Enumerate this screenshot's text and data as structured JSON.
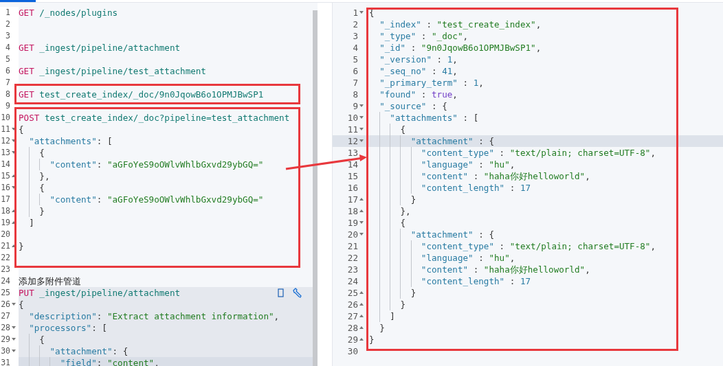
{
  "request_pane": {
    "action_icons": true,
    "lines": [
      {
        "n": "1",
        "fold_open": false,
        "fold_close": false,
        "framed": false,
        "in_request": false,
        "active": false,
        "tokens": [
          {
            "kind": "method",
            "text": "GET"
          },
          {
            "kind": "url",
            "text": "/_nodes/plugins"
          }
        ]
      },
      {
        "n": "2",
        "fold_open": false,
        "fold_close": false,
        "framed": false,
        "in_request": false,
        "active": false
      },
      {
        "n": "3",
        "fold_open": false,
        "fold_close": false,
        "framed": false,
        "in_request": false,
        "active": false
      },
      {
        "n": "4",
        "fold_open": false,
        "fold_close": false,
        "framed": false,
        "in_request": false,
        "active": false,
        "tokens": [
          {
            "kind": "method",
            "text": "GET"
          },
          {
            "kind": "url",
            "text": "_ingest/pipeline/attachment"
          }
        ]
      },
      {
        "n": "5",
        "fold_open": false,
        "fold_close": false,
        "framed": false,
        "in_request": false,
        "active": false
      },
      {
        "n": "6",
        "fold_open": false,
        "fold_close": false,
        "framed": false,
        "in_request": false,
        "active": false,
        "tokens": [
          {
            "kind": "method",
            "text": "GET"
          },
          {
            "kind": "url",
            "text": "_ingest/pipeline/test_attachment"
          }
        ]
      },
      {
        "n": "7",
        "fold_open": false,
        "fold_close": false,
        "framed": false,
        "in_request": false,
        "active": false
      },
      {
        "n": "8",
        "fold_open": false,
        "fold_close": false,
        "framed": true,
        "in_request": false,
        "active": false,
        "tokens": [
          {
            "kind": "method",
            "text": "GET"
          },
          {
            "kind": "url",
            "text": "test_create_index/_doc/9n0JqowB6o1OPMJBwSP1"
          }
        ]
      },
      {
        "n": "9",
        "fold_open": false,
        "fold_close": false,
        "framed": false,
        "in_request": false,
        "active": false
      },
      {
        "n": "10",
        "fold_open": false,
        "fold_close": false,
        "framed": true,
        "in_request": false,
        "active": false,
        "tokens": [
          {
            "kind": "method",
            "text": "POST"
          },
          {
            "kind": "url",
            "text": "test_create_index/_doc?pipeline=test_attachment"
          }
        ]
      },
      {
        "n": "11",
        "fold_open": true,
        "fold_close": false,
        "framed": true,
        "in_request": false,
        "active": false,
        "tokens": [
          {
            "kind": "punct",
            "text": "{"
          }
        ]
      },
      {
        "n": "12",
        "fold_open": true,
        "fold_close": false,
        "framed": true,
        "in_request": false,
        "active": false,
        "tokens": [
          {
            "kind": "key",
            "text": "  \"attachments\""
          },
          {
            "kind": "punct",
            "text": ": ["
          }
        ]
      },
      {
        "n": "13",
        "fold_open": true,
        "fold_close": false,
        "framed": true,
        "in_request": false,
        "active": false,
        "tokens": [
          {
            "kind": "punct",
            "text": "    {"
          }
        ]
      },
      {
        "n": "14",
        "fold_open": false,
        "fold_close": false,
        "framed": true,
        "in_request": false,
        "active": false,
        "tokens": [
          {
            "kind": "key",
            "text": "      \"content\""
          },
          {
            "kind": "punct",
            "text": ": "
          },
          {
            "kind": "string",
            "text": "\"aGFoYeS9oOWlvWhlbGxvd29ybGQ=\""
          }
        ]
      },
      {
        "n": "15",
        "fold_open": false,
        "fold_close": true,
        "framed": true,
        "in_request": false,
        "active": false,
        "tokens": [
          {
            "kind": "punct",
            "text": "    },"
          }
        ]
      },
      {
        "n": "16",
        "fold_open": true,
        "fold_close": false,
        "framed": true,
        "in_request": false,
        "active": false,
        "tokens": [
          {
            "kind": "punct",
            "text": "    {"
          }
        ]
      },
      {
        "n": "17",
        "fold_open": false,
        "fold_close": false,
        "framed": true,
        "in_request": false,
        "active": false,
        "tokens": [
          {
            "kind": "key",
            "text": "      \"content\""
          },
          {
            "kind": "punct",
            "text": ": "
          },
          {
            "kind": "string",
            "text": "\"aGFoYeS9oOWlvWhlbGxvd29ybGQ=\""
          }
        ]
      },
      {
        "n": "18",
        "fold_open": false,
        "fold_close": true,
        "framed": true,
        "in_request": false,
        "active": false,
        "tokens": [
          {
            "kind": "punct",
            "text": "    }"
          }
        ]
      },
      {
        "n": "19",
        "fold_open": false,
        "fold_close": true,
        "framed": true,
        "in_request": false,
        "active": false,
        "tokens": [
          {
            "kind": "punct",
            "text": "  ]"
          }
        ]
      },
      {
        "n": "20",
        "fold_open": false,
        "fold_close": false,
        "framed": true,
        "in_request": false,
        "active": false
      },
      {
        "n": "21",
        "fold_open": false,
        "fold_close": true,
        "framed": true,
        "in_request": false,
        "active": false,
        "tokens": [
          {
            "kind": "punct",
            "text": "}"
          }
        ]
      },
      {
        "n": "22",
        "fold_open": false,
        "fold_close": false,
        "framed": true,
        "in_request": false,
        "active": false
      },
      {
        "n": "23",
        "fold_open": false,
        "fold_close": false,
        "framed": false,
        "in_request": false,
        "active": false
      },
      {
        "n": "24",
        "fold_open": false,
        "fold_close": false,
        "framed": false,
        "in_request": false,
        "active": false,
        "tokens": [
          {
            "kind": "comment",
            "text": "添加多附件管道"
          }
        ]
      },
      {
        "n": "25",
        "fold_open": false,
        "fold_close": false,
        "framed": false,
        "in_request": true,
        "active": false,
        "tokens": [
          {
            "kind": "method",
            "text": "PUT"
          },
          {
            "kind": "url",
            "text": "_ingest/pipeline/attachment"
          }
        ]
      },
      {
        "n": "26",
        "fold_open": true,
        "fold_close": false,
        "framed": false,
        "in_request": true,
        "active": false,
        "tokens": [
          {
            "kind": "punct",
            "text": "{"
          }
        ]
      },
      {
        "n": "27",
        "fold_open": false,
        "fold_close": false,
        "framed": false,
        "in_request": true,
        "active": false,
        "tokens": [
          {
            "kind": "key",
            "text": "  \"description\""
          },
          {
            "kind": "punct",
            "text": ": "
          },
          {
            "kind": "string",
            "text": "\"Extract attachment information\""
          },
          {
            "kind": "punct",
            "text": ","
          }
        ]
      },
      {
        "n": "28",
        "fold_open": true,
        "fold_close": false,
        "framed": false,
        "in_request": true,
        "active": false,
        "tokens": [
          {
            "kind": "key",
            "text": "  \"processors\""
          },
          {
            "kind": "punct",
            "text": ": ["
          }
        ]
      },
      {
        "n": "29",
        "fold_open": true,
        "fold_close": false,
        "framed": false,
        "in_request": true,
        "active": false,
        "tokens": [
          {
            "kind": "punct",
            "text": "    {"
          }
        ]
      },
      {
        "n": "30",
        "fold_open": true,
        "fold_close": false,
        "framed": false,
        "in_request": true,
        "active": false,
        "tokens": [
          {
            "kind": "key",
            "text": "      \"attachment\""
          },
          {
            "kind": "punct",
            "text": ": {"
          }
        ]
      },
      {
        "n": "31",
        "fold_open": false,
        "fold_close": false,
        "framed": false,
        "in_request": true,
        "active": true,
        "tokens": [
          {
            "kind": "key",
            "text": "        \"field\""
          },
          {
            "kind": "punct",
            "text": ": "
          },
          {
            "kind": "string",
            "text": "\"content\""
          },
          {
            "kind": "punct",
            "text": ","
          }
        ]
      }
    ]
  },
  "response_pane": {
    "lines": [
      {
        "n": "1",
        "fold_open": true,
        "fold_close": false,
        "framed": true,
        "active": false,
        "tokens": [
          {
            "kind": "punct",
            "text": "{"
          }
        ]
      },
      {
        "n": "2",
        "fold_open": false,
        "fold_close": false,
        "framed": true,
        "active": false,
        "tokens": [
          {
            "kind": "key",
            "text": "  \"_index\""
          },
          {
            "kind": "punct",
            "text": " : "
          },
          {
            "kind": "string",
            "text": "\"test_create_index\""
          },
          {
            "kind": "punct",
            "text": ","
          }
        ]
      },
      {
        "n": "3",
        "fold_open": false,
        "fold_close": false,
        "framed": true,
        "active": false,
        "tokens": [
          {
            "kind": "key",
            "text": "  \"_type\""
          },
          {
            "kind": "punct",
            "text": " : "
          },
          {
            "kind": "string",
            "text": "\"_doc\""
          },
          {
            "kind": "punct",
            "text": ","
          }
        ]
      },
      {
        "n": "4",
        "fold_open": false,
        "fold_close": false,
        "framed": true,
        "active": false,
        "tokens": [
          {
            "kind": "key",
            "text": "  \"_id\""
          },
          {
            "kind": "punct",
            "text": " : "
          },
          {
            "kind": "string",
            "text": "\"9n0JqowB6o1OPMJBwSP1\""
          },
          {
            "kind": "punct",
            "text": ","
          }
        ]
      },
      {
        "n": "5",
        "fold_open": false,
        "fold_close": false,
        "framed": true,
        "active": false,
        "tokens": [
          {
            "kind": "key",
            "text": "  \"_version\""
          },
          {
            "kind": "punct",
            "text": " : "
          },
          {
            "kind": "number",
            "text": "1"
          },
          {
            "kind": "punct",
            "text": ","
          }
        ]
      },
      {
        "n": "6",
        "fold_open": false,
        "fold_close": false,
        "framed": true,
        "active": false,
        "tokens": [
          {
            "kind": "key",
            "text": "  \"_seq_no\""
          },
          {
            "kind": "punct",
            "text": " : "
          },
          {
            "kind": "number",
            "text": "41"
          },
          {
            "kind": "punct",
            "text": ","
          }
        ]
      },
      {
        "n": "7",
        "fold_open": false,
        "fold_close": false,
        "framed": true,
        "active": false,
        "tokens": [
          {
            "kind": "key",
            "text": "  \"_primary_term\""
          },
          {
            "kind": "punct",
            "text": " : "
          },
          {
            "kind": "number",
            "text": "1"
          },
          {
            "kind": "punct",
            "text": ","
          }
        ]
      },
      {
        "n": "8",
        "fold_open": false,
        "fold_close": false,
        "framed": true,
        "active": false,
        "tokens": [
          {
            "kind": "key",
            "text": "  \"found\""
          },
          {
            "kind": "punct",
            "text": " : "
          },
          {
            "kind": "boolean",
            "text": "true"
          },
          {
            "kind": "punct",
            "text": ","
          }
        ]
      },
      {
        "n": "9",
        "fold_open": true,
        "fold_close": false,
        "framed": true,
        "active": false,
        "tokens": [
          {
            "kind": "key",
            "text": "  \"_source\""
          },
          {
            "kind": "punct",
            "text": " : {"
          }
        ]
      },
      {
        "n": "10",
        "fold_open": true,
        "fold_close": false,
        "framed": true,
        "active": false,
        "tokens": [
          {
            "kind": "key",
            "text": "    \"attachments\""
          },
          {
            "kind": "punct",
            "text": " : ["
          }
        ]
      },
      {
        "n": "11",
        "fold_open": true,
        "fold_close": false,
        "framed": true,
        "active": false,
        "tokens": [
          {
            "kind": "punct",
            "text": "      {"
          }
        ]
      },
      {
        "n": "12",
        "fold_open": true,
        "fold_close": false,
        "framed": true,
        "active": true,
        "tokens": [
          {
            "kind": "key",
            "text": "        \"attachment\""
          },
          {
            "kind": "punct",
            "text": " : {"
          }
        ]
      },
      {
        "n": "13",
        "fold_open": false,
        "fold_close": false,
        "framed": true,
        "active": false,
        "tokens": [
          {
            "kind": "key",
            "text": "          \"content_type\""
          },
          {
            "kind": "punct",
            "text": " : "
          },
          {
            "kind": "string",
            "text": "\"text/plain; charset=UTF-8\""
          },
          {
            "kind": "punct",
            "text": ","
          }
        ]
      },
      {
        "n": "14",
        "fold_open": false,
        "fold_close": false,
        "framed": true,
        "active": false,
        "tokens": [
          {
            "kind": "key",
            "text": "          \"language\""
          },
          {
            "kind": "punct",
            "text": " : "
          },
          {
            "kind": "string",
            "text": "\"hu\""
          },
          {
            "kind": "punct",
            "text": ","
          }
        ]
      },
      {
        "n": "15",
        "fold_open": false,
        "fold_close": false,
        "framed": true,
        "active": false,
        "tokens": [
          {
            "kind": "key",
            "text": "          \"content\""
          },
          {
            "kind": "punct",
            "text": " : "
          },
          {
            "kind": "string",
            "text": "\"haha你好helloworld\""
          },
          {
            "kind": "punct",
            "text": ","
          }
        ]
      },
      {
        "n": "16",
        "fold_open": false,
        "fold_close": false,
        "framed": true,
        "active": false,
        "tokens": [
          {
            "kind": "key",
            "text": "          \"content_length\""
          },
          {
            "kind": "punct",
            "text": " : "
          },
          {
            "kind": "number",
            "text": "17"
          }
        ]
      },
      {
        "n": "17",
        "fold_open": false,
        "fold_close": true,
        "framed": true,
        "active": false,
        "tokens": [
          {
            "kind": "punct",
            "text": "        }"
          }
        ]
      },
      {
        "n": "18",
        "fold_open": false,
        "fold_close": true,
        "framed": true,
        "active": false,
        "tokens": [
          {
            "kind": "punct",
            "text": "      },"
          }
        ]
      },
      {
        "n": "19",
        "fold_open": true,
        "fold_close": false,
        "framed": true,
        "active": false,
        "tokens": [
          {
            "kind": "punct",
            "text": "      {"
          }
        ]
      },
      {
        "n": "20",
        "fold_open": true,
        "fold_close": false,
        "framed": true,
        "active": false,
        "tokens": [
          {
            "kind": "key",
            "text": "        \"attachment\""
          },
          {
            "kind": "punct",
            "text": " : {"
          }
        ]
      },
      {
        "n": "21",
        "fold_open": false,
        "fold_close": false,
        "framed": true,
        "active": false,
        "tokens": [
          {
            "kind": "key",
            "text": "          \"content_type\""
          },
          {
            "kind": "punct",
            "text": " : "
          },
          {
            "kind": "string",
            "text": "\"text/plain; charset=UTF-8\""
          },
          {
            "kind": "punct",
            "text": ","
          }
        ]
      },
      {
        "n": "22",
        "fold_open": false,
        "fold_close": false,
        "framed": true,
        "active": false,
        "tokens": [
          {
            "kind": "key",
            "text": "          \"language\""
          },
          {
            "kind": "punct",
            "text": " : "
          },
          {
            "kind": "string",
            "text": "\"hu\""
          },
          {
            "kind": "punct",
            "text": ","
          }
        ]
      },
      {
        "n": "23",
        "fold_open": false,
        "fold_close": false,
        "framed": true,
        "active": false,
        "tokens": [
          {
            "kind": "key",
            "text": "          \"content\""
          },
          {
            "kind": "punct",
            "text": " : "
          },
          {
            "kind": "string",
            "text": "\"haha你好helloworld\""
          },
          {
            "kind": "punct",
            "text": ","
          }
        ]
      },
      {
        "n": "24",
        "fold_open": false,
        "fold_close": false,
        "framed": true,
        "active": false,
        "tokens": [
          {
            "kind": "key",
            "text": "          \"content_length\""
          },
          {
            "kind": "punct",
            "text": " : "
          },
          {
            "kind": "number",
            "text": "17"
          }
        ]
      },
      {
        "n": "25",
        "fold_open": false,
        "fold_close": true,
        "framed": true,
        "active": false,
        "tokens": [
          {
            "kind": "punct",
            "text": "        }"
          }
        ]
      },
      {
        "n": "26",
        "fold_open": false,
        "fold_close": true,
        "framed": true,
        "active": false,
        "tokens": [
          {
            "kind": "punct",
            "text": "      }"
          }
        ]
      },
      {
        "n": "27",
        "fold_open": false,
        "fold_close": true,
        "framed": true,
        "active": false,
        "tokens": [
          {
            "kind": "punct",
            "text": "    ]"
          }
        ]
      },
      {
        "n": "28",
        "fold_open": false,
        "fold_close": true,
        "framed": true,
        "active": false,
        "tokens": [
          {
            "kind": "punct",
            "text": "  }"
          }
        ]
      },
      {
        "n": "29",
        "fold_open": false,
        "fold_close": true,
        "framed": true,
        "active": false,
        "tokens": [
          {
            "kind": "punct",
            "text": "}"
          }
        ]
      },
      {
        "n": "30",
        "fold_open": false,
        "fold_close": false,
        "framed": false,
        "active": false
      }
    ]
  },
  "annotations": [
    {
      "kind": "arrow"
    }
  ]
}
